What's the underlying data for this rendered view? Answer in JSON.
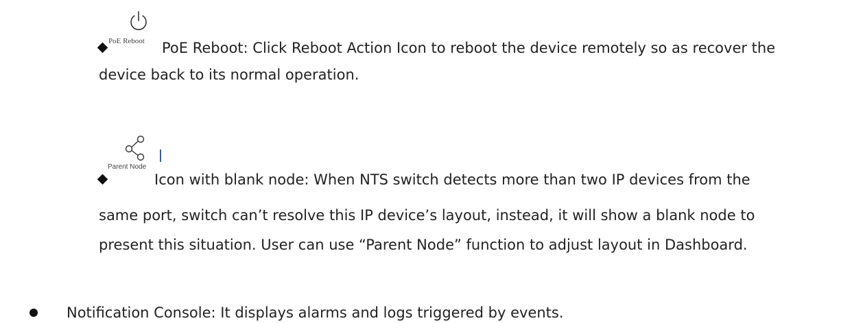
{
  "poe_reboot": {
    "icon": "power-icon",
    "caption": "PoE Reboot",
    "line1": "PoE Reboot: Click Reboot Action Icon to reboot the device remotely so as recover the",
    "line2": "device back to its normal operation."
  },
  "parent_node": {
    "icon": "share-node-icon",
    "caption": "Parent Node",
    "line1": "Icon with blank node: When NTS switch detects more than two IP devices from the",
    "line2": "same port, switch can’t resolve this IP device’s layout, instead, it will show a blank node to",
    "line3": "present this situation. User can use “Parent Node” function to adjust layout in Dashboard."
  },
  "notification_console": {
    "text": "Notification Console: It displays alarms and logs triggered by events."
  }
}
